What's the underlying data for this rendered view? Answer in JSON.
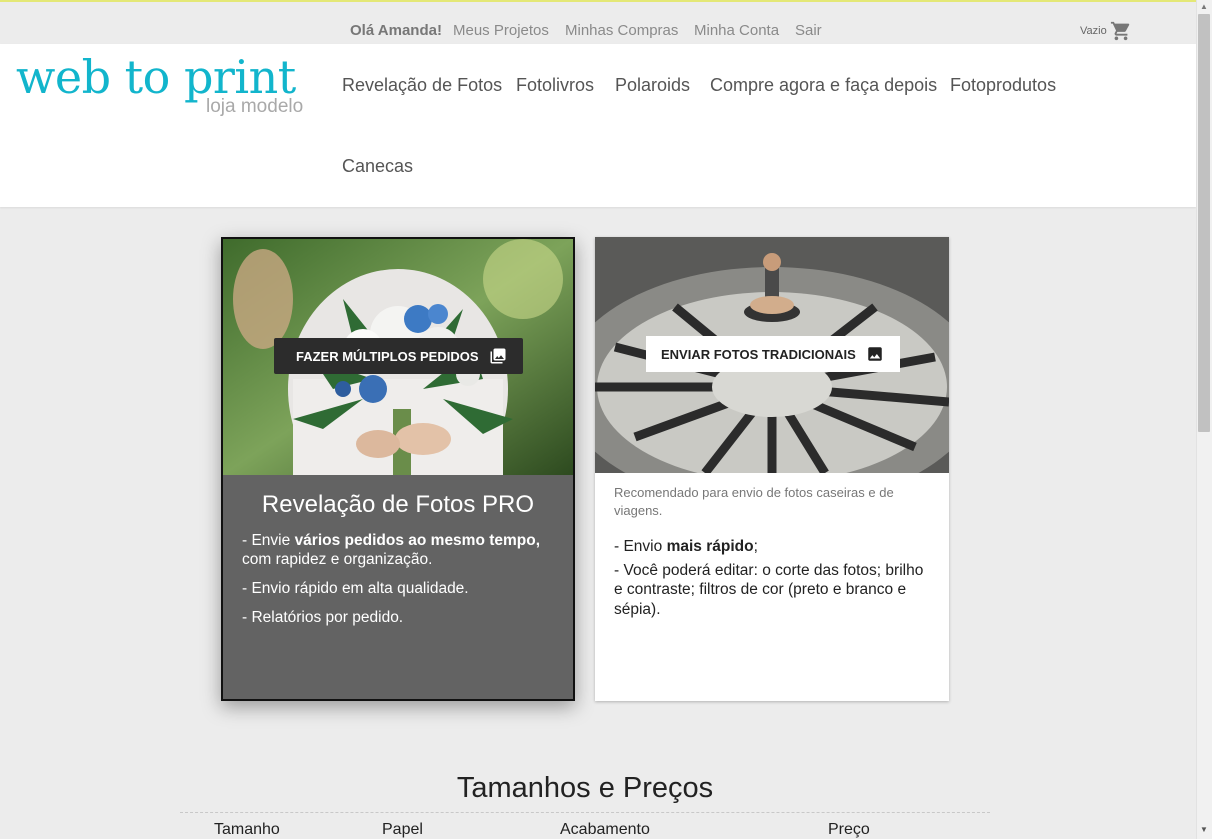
{
  "util_nav": {
    "greeting": "Olá Amanda!",
    "links": [
      "Meus Projetos",
      "Minhas Compras",
      "Minha Conta",
      "Sair"
    ],
    "cart_label": "Vazio"
  },
  "logo": {
    "main": "web to print",
    "sub": "loja modelo"
  },
  "main_nav": [
    "Revelação de Fotos",
    "Fotolivros",
    "Polaroids",
    "Compre agora e faça depois",
    "Fotoprodutos",
    "Canecas"
  ],
  "cards": {
    "pro": {
      "button": "FAZER MÚLTIPLOS PEDIDOS",
      "title": "Revelação de Fotos PRO",
      "item1_pre": "- Envie ",
      "item1_bold": "vários pedidos ao mesmo tempo,",
      "item1_post": " com rapidez e organização.",
      "item2": "- Envio rápido em alta qualidade.",
      "item3": "- Relatórios por pedido."
    },
    "trad": {
      "button": "ENVIAR FOTOS TRADICIONAIS",
      "recommend": "Recomendado para envio de fotos caseiras e de viagens.",
      "item1_pre": "- Envio ",
      "item1_bold": "mais rápido",
      "item1_post": ";",
      "item2": "- Você poderá editar: o corte das fotos; brilho e contraste; filtros de cor (preto e branco e sépia)."
    }
  },
  "pricing": {
    "title": "Tamanhos e Preços",
    "columns": [
      "Tamanho",
      "Papel",
      "Acabamento",
      "Preço"
    ]
  },
  "colors": {
    "brand": "#12b5cc",
    "accent": "#e4e876",
    "pro_card": "#636363"
  },
  "icons": {
    "cart": "cart-icon",
    "multi": "photo-library-icon",
    "single": "image-icon"
  }
}
